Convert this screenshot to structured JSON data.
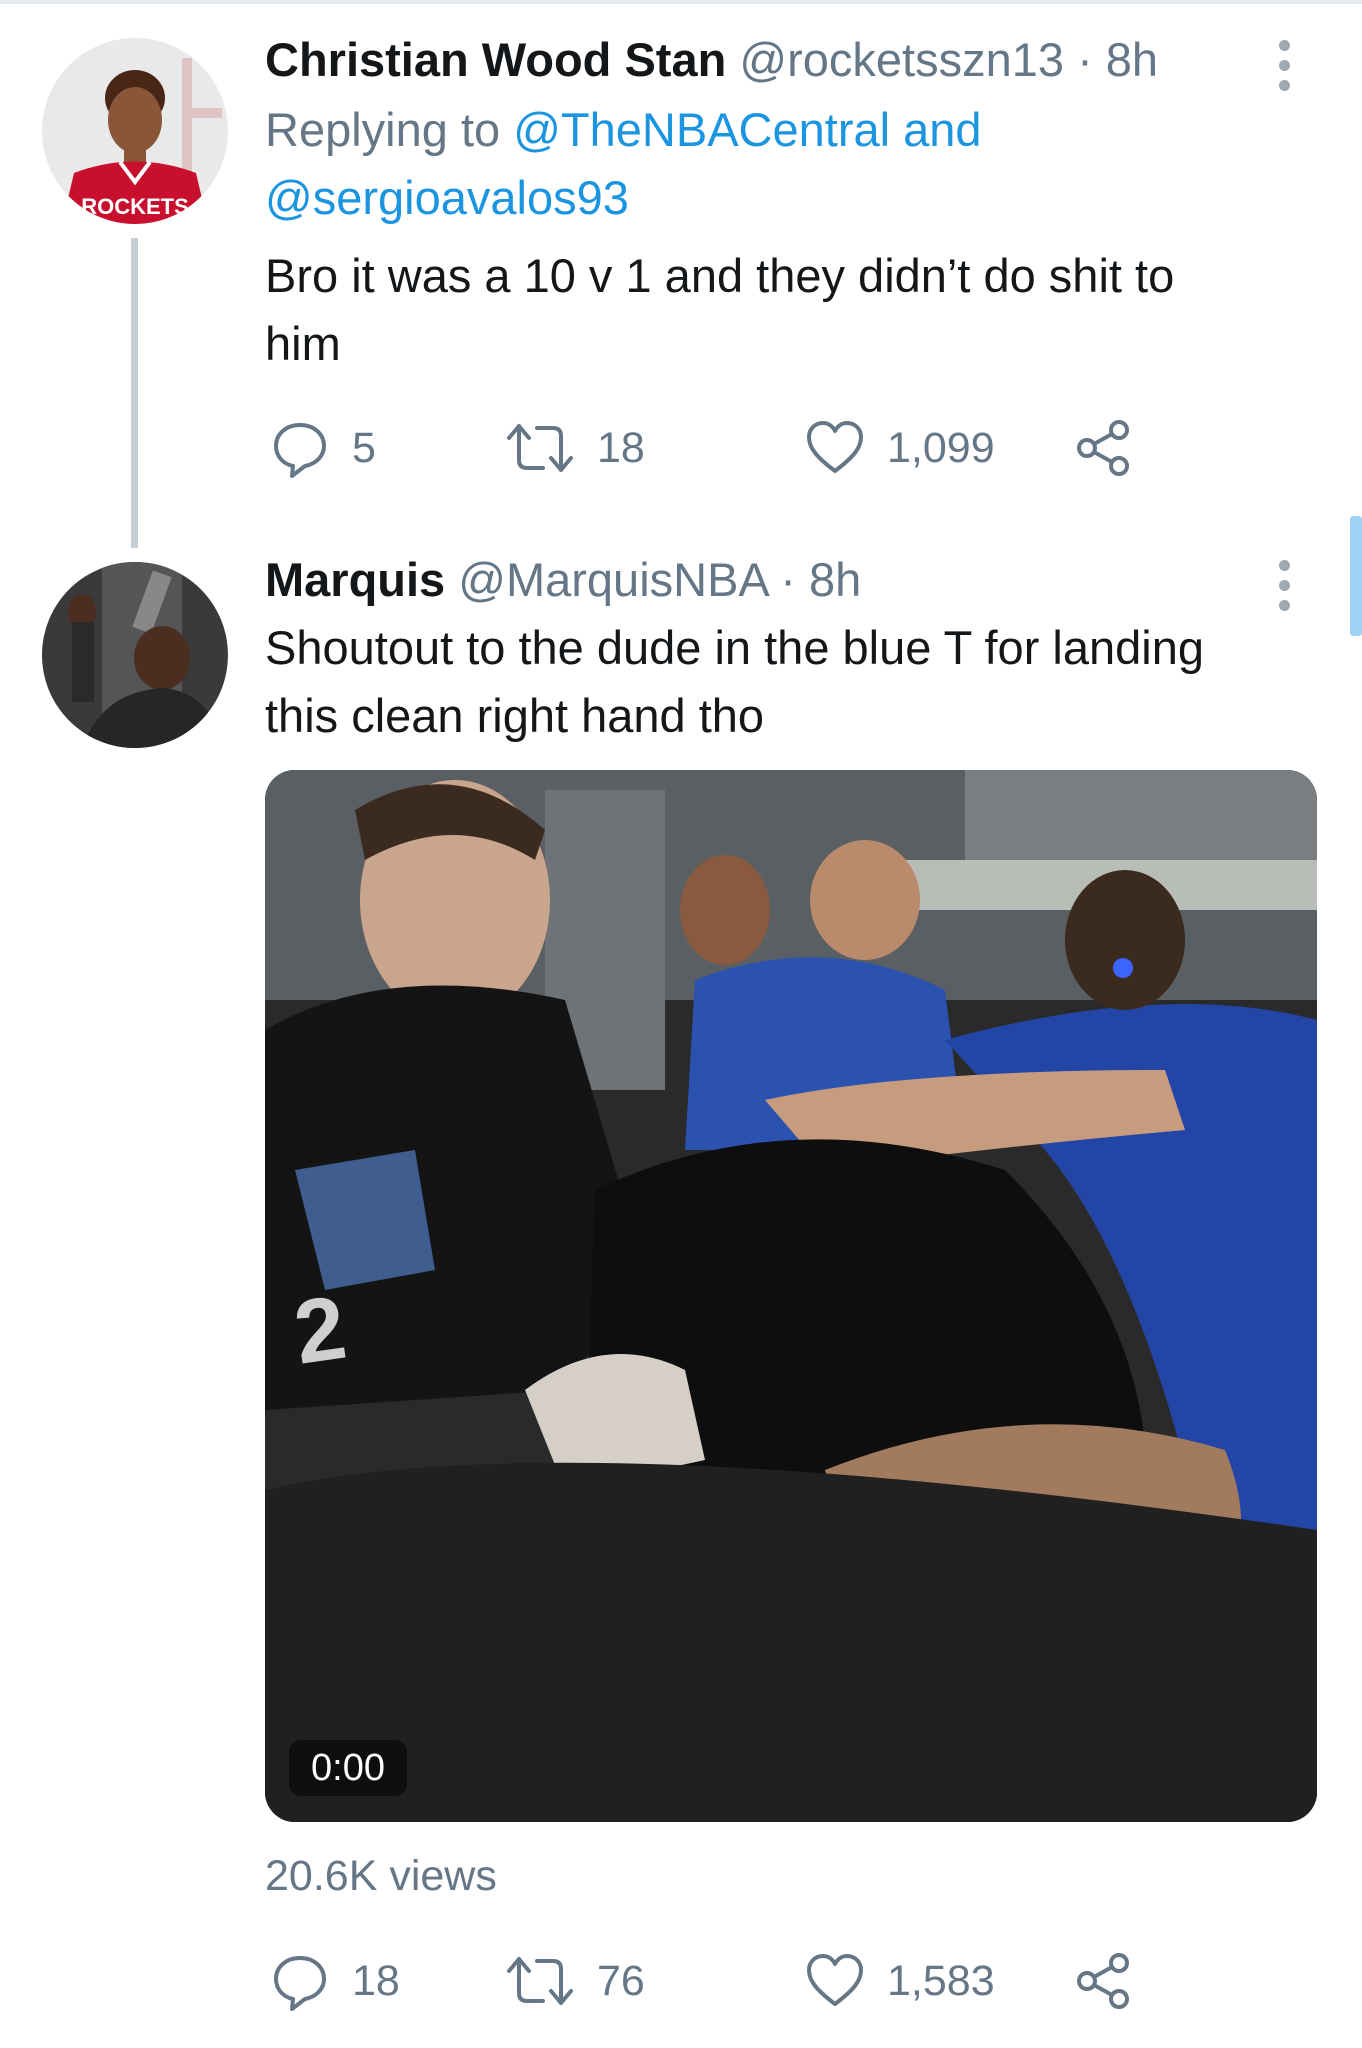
{
  "tweets": [
    {
      "display_name": "Christian Wood Stan",
      "handle": "@rocketsszn13",
      "time": "8h",
      "separator": "·",
      "replying_prefix": "Replying to",
      "replying_mention_1": "@TheNBACentral",
      "replying_and": "and",
      "replying_mention_2": "@sergioavalos93",
      "text_line_1": "Bro it was a 10 v 1 and they didn’t do shit to",
      "text_line_2": "him",
      "replies": "5",
      "retweets": "18",
      "likes": "1,099",
      "avatar_jersey_text": "ROCKETS"
    },
    {
      "display_name": "Marquis",
      "handle": "@MarquisNBA",
      "time": "8h",
      "separator": "·",
      "text_line_1": "Shoutout to the dude in the blue T for landing",
      "text_line_2": "this clean right hand tho",
      "video_time": "0:00",
      "video_jersey_number": "2",
      "views": "20.6K views",
      "replies": "18",
      "retweets": "76",
      "likes": "1,583"
    }
  ],
  "icons": {
    "reply": "reply-icon",
    "retweet": "retweet-icon",
    "like": "heart-icon",
    "share": "share-icon",
    "more": "more-vertical-icon"
  },
  "colors": {
    "text_primary": "#14171a",
    "text_secondary": "#657786",
    "link": "#1b95e0",
    "thread_line": "#c4cfd6"
  }
}
